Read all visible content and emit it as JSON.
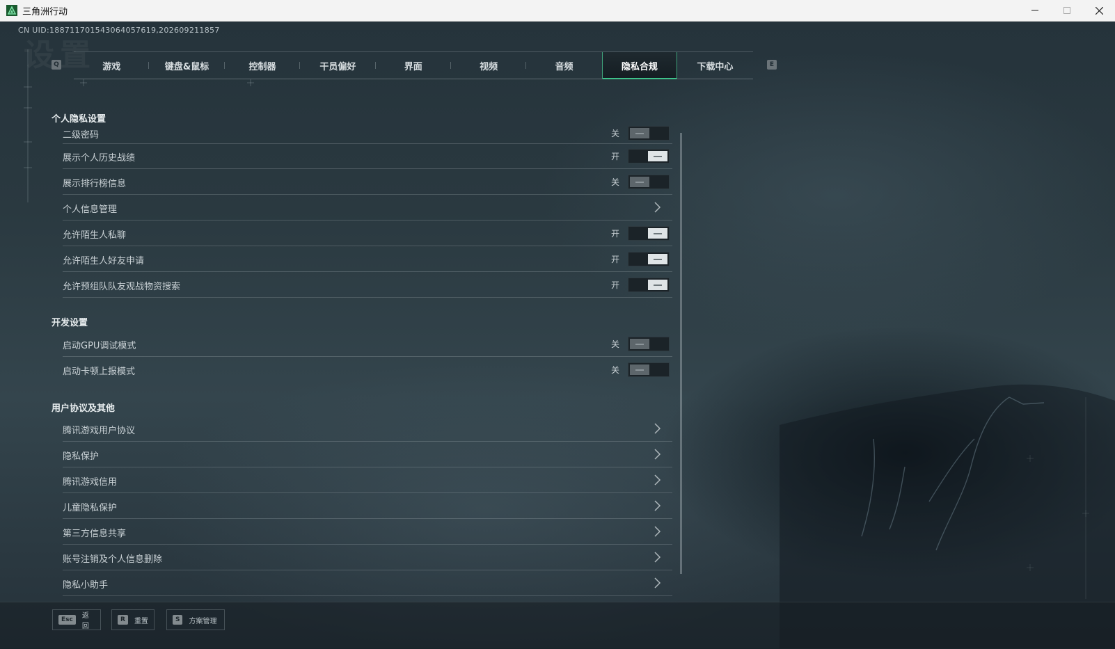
{
  "window": {
    "title": "三角洲行动"
  },
  "uid": "CN UID:18871170154306405761​9,202609211857",
  "watermark": "设置",
  "tabs": {
    "left_key": "Q",
    "right_key": "E",
    "items": [
      {
        "label": "游戏"
      },
      {
        "label": "键盘&鼠标"
      },
      {
        "label": "控制器"
      },
      {
        "label": "干员偏好"
      },
      {
        "label": "界面"
      },
      {
        "label": "视频"
      },
      {
        "label": "音频"
      },
      {
        "label": "隐私合规",
        "active": true
      },
      {
        "label": "下载中心"
      }
    ]
  },
  "sections": {
    "privacy": {
      "title": "个人隐私设置",
      "rows": [
        {
          "label": "二级密码",
          "state": "关",
          "type": "toggle-off"
        },
        {
          "label": "展示个人历史战绩",
          "state": "开",
          "type": "toggle-on"
        },
        {
          "label": "展示排行榜信息",
          "state": "关",
          "type": "toggle-off"
        },
        {
          "label": "个人信息管理",
          "type": "link"
        },
        {
          "label": "允许陌生人私聊",
          "state": "开",
          "type": "toggle-on"
        },
        {
          "label": "允许陌生人好友申请",
          "state": "开",
          "type": "toggle-on"
        },
        {
          "label": "允许预组队队友观战物资搜索",
          "state": "开",
          "type": "toggle-on"
        }
      ]
    },
    "dev": {
      "title": "开发设置",
      "rows": [
        {
          "label": "启动GPU调试模式",
          "state": "关",
          "type": "toggle-off"
        },
        {
          "label": "启动卡顿上报模式",
          "state": "关",
          "type": "toggle-off"
        }
      ]
    },
    "agreements": {
      "title": "用户协议及其他",
      "rows": [
        {
          "label": "腾讯游戏用户协议",
          "type": "link"
        },
        {
          "label": "隐私保护",
          "type": "link"
        },
        {
          "label": "腾讯游戏信用",
          "type": "link"
        },
        {
          "label": "儿童隐私保护",
          "type": "link"
        },
        {
          "label": "第三方信息共享",
          "type": "link"
        },
        {
          "label": "账号注销及个人信息删除",
          "type": "link"
        },
        {
          "label": "隐私小助手",
          "type": "link"
        }
      ]
    }
  },
  "bottom": {
    "back": {
      "key": "Esc",
      "label": "返回"
    },
    "reset": {
      "key": "R",
      "label": "重置"
    },
    "scheme": {
      "key": "S",
      "label": "方案管理"
    }
  },
  "colors": {
    "accent": "#3ec28a",
    "title_bar": "#f3f3f3"
  }
}
